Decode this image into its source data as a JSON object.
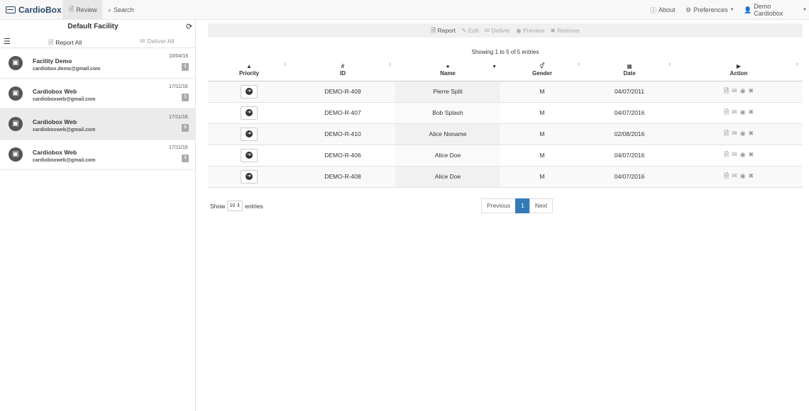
{
  "app": {
    "brand": "CardioBox"
  },
  "nav": {
    "left": [
      {
        "label": "Review",
        "icon": "document-icon",
        "active": true
      },
      {
        "label": "Search",
        "icon": "search-icon",
        "active": false
      }
    ],
    "right": [
      {
        "label": "About",
        "icon": "info-icon"
      },
      {
        "label": "Preferences",
        "icon": "gear-icon"
      },
      {
        "label": "Demo Cardiobox",
        "icon": "user-icon"
      }
    ]
  },
  "sidebar": {
    "title": "Default Facility",
    "report_all": "Report All",
    "deliver_all": "Deliver All",
    "facilities": [
      {
        "name": "Facility Demo",
        "email": "cardiobox.demo@gmail.com",
        "date": "10/04/16",
        "badge": "1"
      },
      {
        "name": "Cardiobox Web",
        "email": "cardioboxweb@gmail.com",
        "date": "17/11/16",
        "badge": "1"
      },
      {
        "name": "Cardiobox Web",
        "email": "cardioboxweb@gmail.com",
        "date": "17/11/16",
        "badge": "5"
      },
      {
        "name": "Cardiobox Web",
        "email": "cardioboxweb@gmail.com",
        "date": "17/11/16",
        "badge": "3"
      }
    ]
  },
  "toolbar": {
    "report": "Report",
    "edit": "Edit",
    "deliver": "Deliver",
    "preview": "Preview",
    "remove": "Remove"
  },
  "table": {
    "info": "Showing 1 to 5 of 5 entries",
    "columns": [
      "Priority",
      "ID",
      "Name",
      "Gender",
      "Date",
      "Action"
    ],
    "column_icons": [
      "warning-icon",
      "hash-icon",
      "user-icon",
      "gender-icon",
      "calendar-icon",
      "play-icon"
    ],
    "id_glyph": "#",
    "rows": [
      {
        "id": "DEMO-R-409",
        "name": "Pierre Split",
        "gender": "M",
        "date": "04/07/2011"
      },
      {
        "id": "DEMO-R-407",
        "name": "Bob Splash",
        "gender": "M",
        "date": "04/07/2016"
      },
      {
        "id": "DEMO-R-410",
        "name": "Alice Noname",
        "gender": "M",
        "date": "02/08/2016"
      },
      {
        "id": "DEMO-R-406",
        "name": "Alice Doe",
        "gender": "M",
        "date": "04/07/2016"
      },
      {
        "id": "DEMO-R-408",
        "name": "Alice Doe",
        "gender": "M",
        "date": "04/07/2016"
      }
    ]
  },
  "footer": {
    "show": "Show",
    "entries": "entries",
    "page_size": "10",
    "previous": "Previous",
    "page": "1",
    "next": "Next"
  }
}
